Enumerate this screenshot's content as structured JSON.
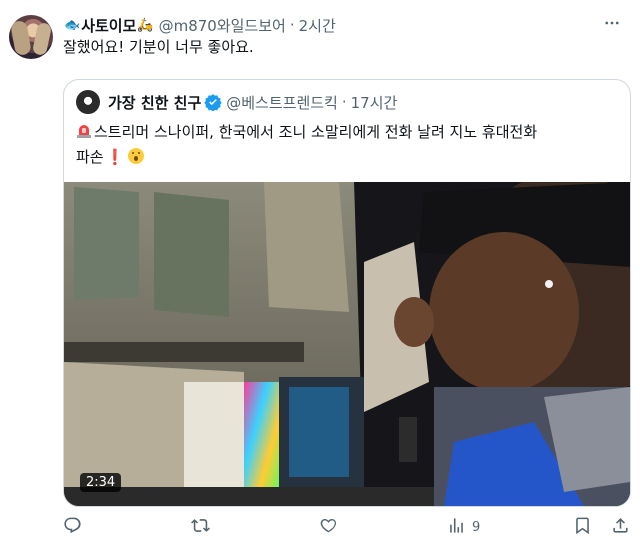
{
  "tweet": {
    "display_name": "사토이모",
    "name_emoji_left": "🐟",
    "name_emoji_right": "🛵",
    "handle": "@m870와일드보어",
    "separator": "·",
    "time": "2시간",
    "text": "잘했어요! 기분이 너무 좋아요."
  },
  "quote": {
    "display_name": "가장 친한 친구",
    "handle": "@베스트프렌드킥",
    "separator": "·",
    "time": "17시간",
    "text_line1": "스트리머 스나이퍼, 한국에서 조니 소말리에게 전화 날려 지노 휴대전화",
    "text_line2": "파손",
    "exclaim": "❗",
    "video_duration": "2:34"
  },
  "actions": {
    "reply_icon": "reply-icon",
    "retweet_icon": "retweet-icon",
    "like_icon": "heart-icon",
    "views_icon": "views-icon",
    "views_count": "9",
    "bookmark_icon": "bookmark-icon",
    "share_icon": "share-icon"
  },
  "colors": {
    "secondary_text": "#536471",
    "border": "#cfd9de",
    "verified": "#1d9bf0"
  }
}
